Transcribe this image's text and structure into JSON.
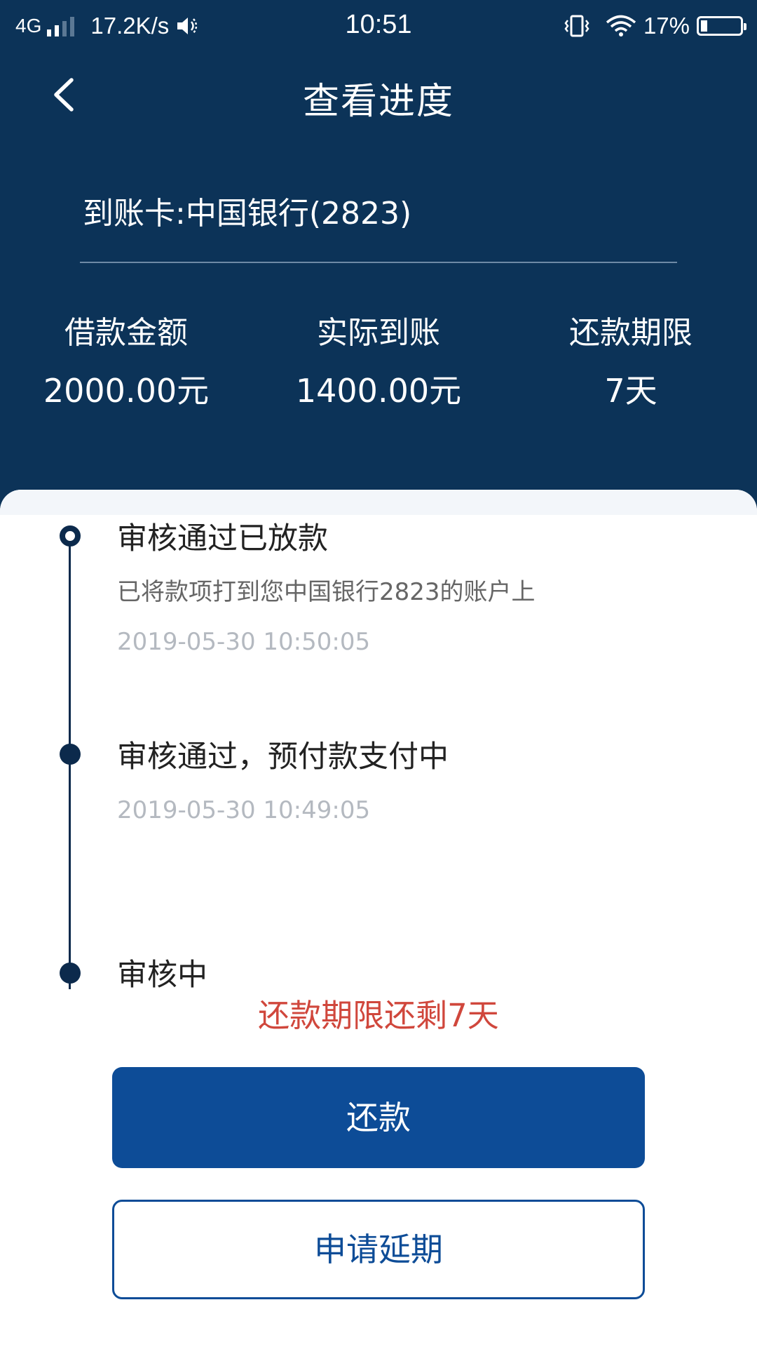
{
  "status_bar": {
    "network": "4G",
    "speed": "17.2K/s",
    "time": "10:51",
    "battery_percent": "17%",
    "battery_level": 0.17,
    "icons": [
      "signal-icon",
      "volume-icon",
      "vibrate-icon",
      "wifi-icon",
      "battery-icon"
    ]
  },
  "header": {
    "title": "查看进度",
    "card": "到账卡:中国银行(2823)",
    "stats": [
      {
        "label": "借款金额",
        "value": "2000.00元"
      },
      {
        "label": "实际到账",
        "value": "1400.00元"
      },
      {
        "label": "还款期限",
        "value": "7天"
      }
    ]
  },
  "timeline": [
    {
      "title": "审核通过已放款",
      "desc": "已将款项打到您中国银行2823的账户上",
      "time": "2019-05-30 10:50:05",
      "current": true
    },
    {
      "title": "审核通过，预付款支付中",
      "time": "2019-05-30 10:49:05"
    },
    {
      "title": "审核中"
    }
  ],
  "remaining_text": "还款期限还剩7天",
  "buttons": {
    "repay": "还款",
    "extend": "申请延期"
  },
  "colors": {
    "header_bg": "#0c3358",
    "primary": "#0d4c97",
    "warning": "#d0473c",
    "timeline": "#0c2a4c"
  }
}
